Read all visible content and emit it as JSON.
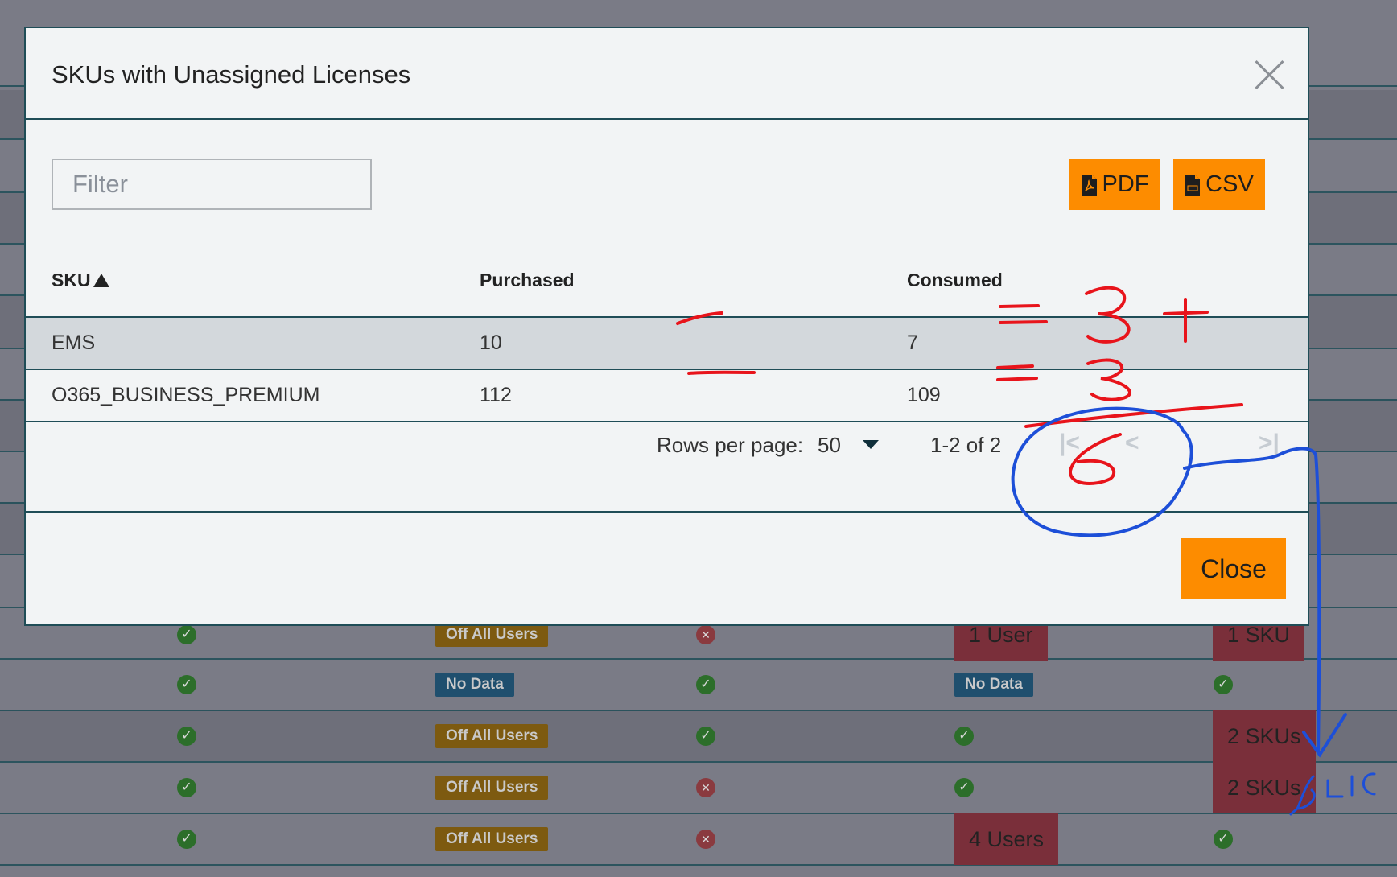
{
  "modal": {
    "title": "SKUs with Unassigned Licenses",
    "filter_placeholder": "Filter",
    "export": {
      "pdf_label": "PDF",
      "csv_label": "CSV"
    },
    "columns": {
      "sku": "SKU",
      "purchased": "Purchased",
      "consumed": "Consumed"
    },
    "sort": {
      "column": "SKU",
      "direction": "ascending"
    },
    "rows": [
      {
        "sku": "EMS",
        "purchased": "10",
        "consumed": "7"
      },
      {
        "sku": "O365_BUSINESS_PREMIUM",
        "purchased": "112",
        "consumed": "109"
      }
    ],
    "pagination": {
      "rows_per_page_label": "Rows per page:",
      "rows_per_page": "50",
      "range": "1-2 of 2"
    },
    "close_label": "Close"
  },
  "background_table": {
    "rows": [
      {
        "c1": "check",
        "c2": "Off All Users",
        "c3": "x",
        "c4": "1 User",
        "c5": "1 SKU"
      },
      {
        "c1": "check",
        "c2": "No Data",
        "c3": "check",
        "c4": "No Data",
        "c5": "check"
      },
      {
        "c1": "check",
        "c2": "Off All Users",
        "c3": "check",
        "c4": "check",
        "c5": "2 SKUs"
      },
      {
        "c1": "check",
        "c2": "Off All Users",
        "c3": "x",
        "c4": "check",
        "c5": "2 SKUs"
      },
      {
        "c1": "check",
        "c2": "Off All Users",
        "c3": "x",
        "c4": "4 Users",
        "c5": "check"
      }
    ]
  },
  "annotations": {
    "red_minus": "-",
    "red_equals": "=",
    "red_results": [
      "3",
      "3"
    ],
    "red_plus": "+",
    "red_total": "6",
    "blue_note": "6 LIC"
  },
  "colors": {
    "accent_orange": "#fd8c00",
    "border_teal": "#1f4d57",
    "annotation_red": "#e8141b",
    "annotation_blue": "#1d4fd8"
  }
}
